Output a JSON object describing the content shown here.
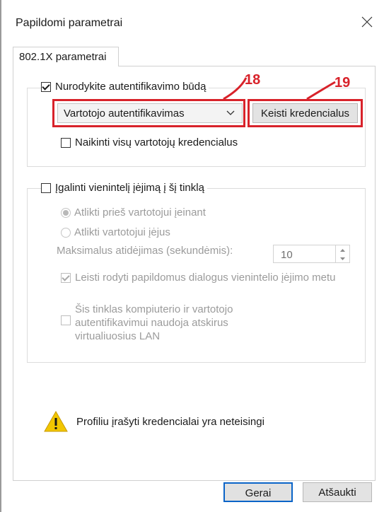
{
  "window": {
    "title": "Papildomi parametrai"
  },
  "tab": {
    "label": "802.1X parametrai"
  },
  "auth_group": {
    "enable_label": "Nurodykite autentifikavimo būdą",
    "enabled": true,
    "mode_selected": "Vartotojo autentifikavimas",
    "replace_credentials_button": "Keisti kredencialus",
    "delete_credentials_label": "Naikinti visų vartotojų kredencialus",
    "delete_credentials_checked": false
  },
  "sso_group": {
    "enable_label": "Įgalinti vienintelį įėjimą į šį tinklą",
    "enabled": false,
    "option_before_label": "Atlikti prieš vartotojui įeinant",
    "option_after_label": "Atlikti vartotojui įėjus",
    "selected_option": "before",
    "max_delay_label": "Maksimalus atidėjimas (sekundėmis):",
    "max_delay_value": "10",
    "allow_dialogs_label": "Leisti rodyti papildomus dialogus vienintelio įėjimo metu",
    "allow_dialogs_checked": true,
    "separate_vlan_label": "Šis tinklas kompiuterio ir vartotojo autentifikavimui naudoja atskirus virtualiuosius LAN",
    "separate_vlan_checked": false
  },
  "warning": {
    "icon": "warning-triangle-icon",
    "text": "Profiliu įrašyti kredencialai yra neteisingi"
  },
  "footer": {
    "ok_label": "Gerai",
    "cancel_label": "Atšaukti"
  },
  "annotations": {
    "callout_18": "18",
    "callout_19": "19"
  },
  "colors": {
    "callout": "#d8222a",
    "default_button_border": "#0a64c8",
    "warning_yellow": "#f2c600"
  }
}
